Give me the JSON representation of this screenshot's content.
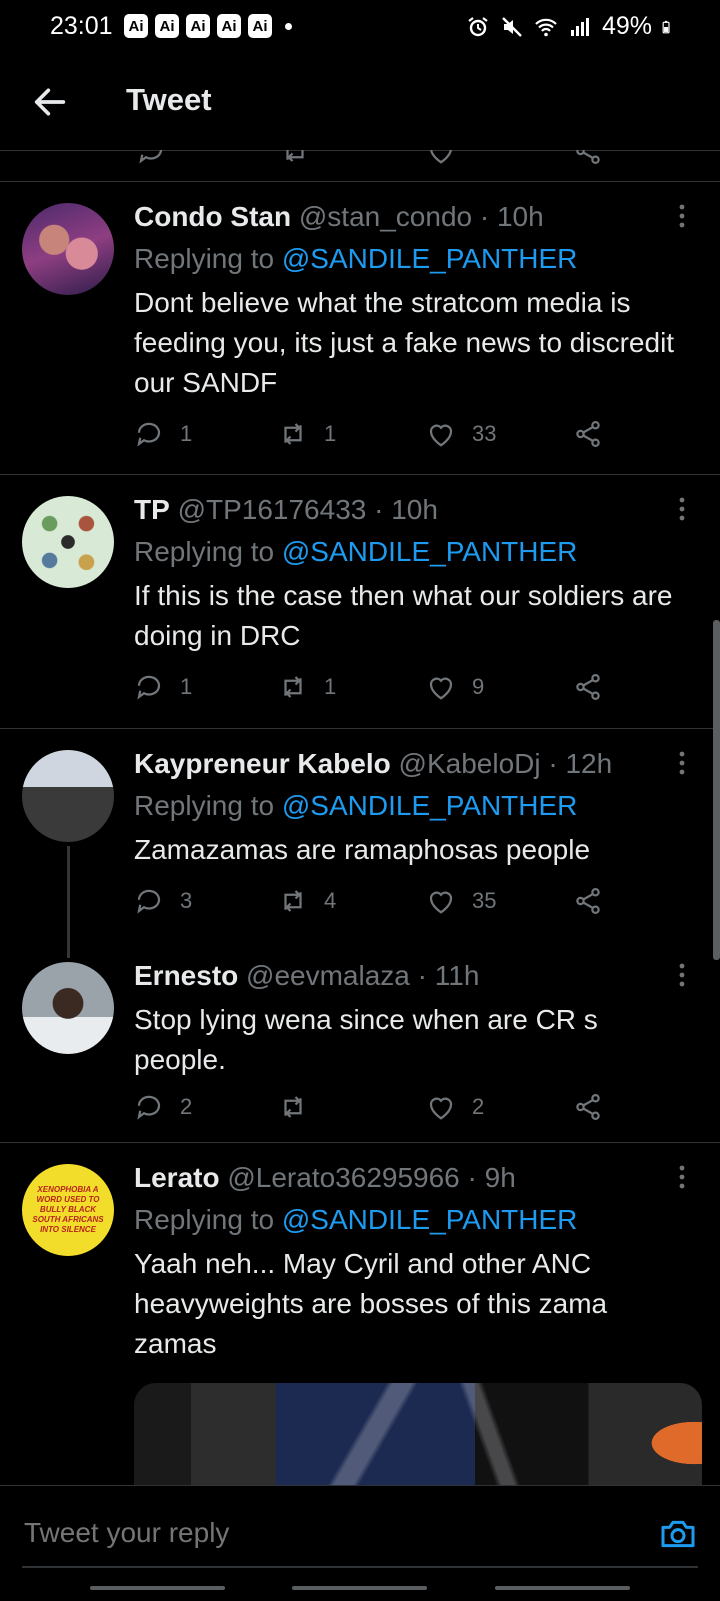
{
  "status_bar": {
    "time": "23:01",
    "badges": [
      "Ai",
      "Ai",
      "Ai",
      "Ai",
      "Ai"
    ],
    "battery": "49%"
  },
  "header": {
    "title": "Tweet"
  },
  "tweets": [
    {
      "name": "Condo Stan",
      "handle": "@stan_condo",
      "time": "· 10h",
      "replying_prefix": "Replying to ",
      "replying_to": "@SANDILE_PANTHER",
      "text": "Dont believe what the stratcom media is feeding you, its just a fake news to discredit our SANDF",
      "replies": "1",
      "retweets": "1",
      "likes": "33"
    },
    {
      "name": "TP",
      "handle": "@TP16176433",
      "time": "· 10h",
      "replying_prefix": "Replying to ",
      "replying_to": "@SANDILE_PANTHER",
      "text": "If this is the case then what our soldiers are doing in DRC",
      "replies": "1",
      "retweets": "1",
      "likes": "9"
    },
    {
      "name": "Kaypreneur Kabelo",
      "handle": "@KabeloDj",
      "time": "· 12h",
      "replying_prefix": "Replying to ",
      "replying_to": "@SANDILE_PANTHER",
      "text": "Zamazamas are ramaphosas people",
      "replies": "3",
      "retweets": "4",
      "likes": "35"
    },
    {
      "name": "Ernesto",
      "handle": "@eevmalaza",
      "time": "· 11h",
      "text": "Stop lying wena since when are CR s people.",
      "replies": "2",
      "retweets": "",
      "likes": "2"
    },
    {
      "name": "Lerato",
      "handle": "@Lerato36295966",
      "time": "· 9h",
      "replying_prefix": "Replying to ",
      "replying_to": "@SANDILE_PANTHER",
      "text": "Yaah neh... May Cyril and other ANC heavyweights are bosses of this zama zamas",
      "avatar_text": "XENOPHOBIA A WORD USED TO BULLY BLACK SOUTH AFRICANS INTO SILENCE"
    }
  ],
  "reply_bar": {
    "placeholder": "Tweet your reply"
  },
  "colors": {
    "accent": "#1d9bf0",
    "muted": "#71767b",
    "text": "#e7e9ea",
    "background": "#000000"
  },
  "icons": [
    "back-arrow-icon",
    "more-icon",
    "reply-icon",
    "retweet-icon",
    "like-icon",
    "share-icon",
    "camera-icon"
  ]
}
